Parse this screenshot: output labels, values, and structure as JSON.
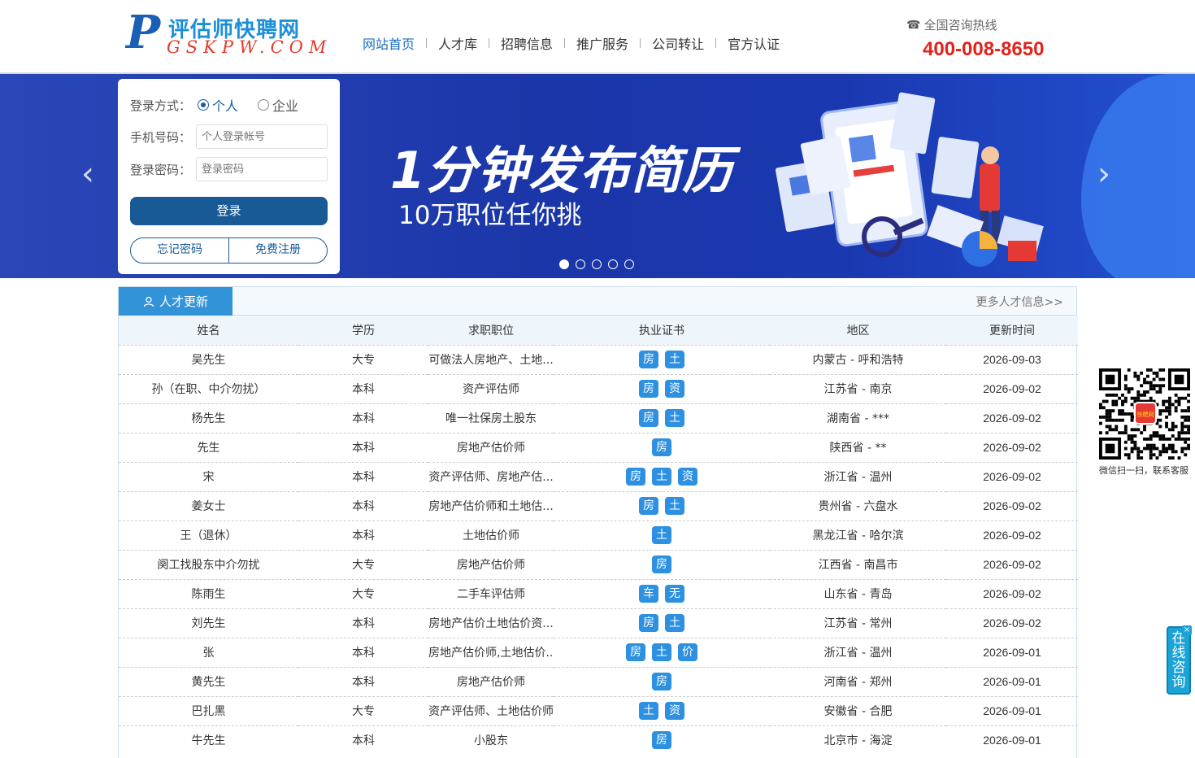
{
  "header": {
    "logo_cn": "评估师快聘网",
    "logo_en": "GSKPW.COM",
    "nav": [
      "网站首页",
      "人才库",
      "招聘信息",
      "推广服务",
      "公司转让",
      "官方认证"
    ],
    "hotline_label": "全国咨询热线",
    "hotline_number": "400-008-8650"
  },
  "banner": {
    "title": "1分钟发布简历",
    "subtitle": "10万职位任你挑",
    "slide_count": 5,
    "active_slide": 1
  },
  "login": {
    "mode_label": "登录方式：",
    "mode_personal": "个人",
    "mode_company": "企业",
    "phone_label": "手机号码：",
    "phone_placeholder": "个人登录帐号",
    "password_label": "登录密码：",
    "password_placeholder": "登录密码",
    "login_button": "登录",
    "forgot_button": "忘记密码",
    "register_button": "免费注册"
  },
  "talent": {
    "tab_title": "人才更新",
    "more_link": "更多人才信息>>",
    "columns": [
      "姓名",
      "学历",
      "求职职位",
      "执业证书",
      "地区",
      "更新时间"
    ],
    "rows": [
      {
        "name": "吴先生",
        "edu": "大专",
        "job": "可做法人房地产、土地...",
        "certs": [
          "房",
          "土"
        ],
        "region": "内蒙古 - 呼和浩特",
        "date": "2026-09-03"
      },
      {
        "name": "孙（在职、中介勿扰）",
        "edu": "本科",
        "job": "资产评估师",
        "certs": [
          "房",
          "资"
        ],
        "region": "江苏省 - 南京",
        "date": "2026-09-02"
      },
      {
        "name": "杨先生",
        "edu": "本科",
        "job": "唯一社保房土股东",
        "certs": [
          "房",
          "土"
        ],
        "region": "湖南省 - ***",
        "date": "2026-09-02"
      },
      {
        "name": "先生",
        "edu": "本科",
        "job": "房地产估价师",
        "certs": [
          "房"
        ],
        "region": "陕西省 - **",
        "date": "2026-09-02"
      },
      {
        "name": "宋",
        "edu": "本科",
        "job": "资产评估师、房地产估...",
        "certs": [
          "房",
          "土",
          "资"
        ],
        "region": "浙江省 - 温州",
        "date": "2026-09-02"
      },
      {
        "name": "姜女士",
        "edu": "本科",
        "job": "房地产估价师和土地估...",
        "certs": [
          "房",
          "土"
        ],
        "region": "贵州省 - 六盘水",
        "date": "2026-09-02"
      },
      {
        "name": "王（退休）",
        "edu": "本科",
        "job": "土地估价师",
        "certs": [
          "土"
        ],
        "region": "黑龙江省 - 哈尔滨",
        "date": "2026-09-02"
      },
      {
        "name": "阕工找股东中介勿扰",
        "edu": "大专",
        "job": "房地产估价师",
        "certs": [
          "房"
        ],
        "region": "江西省 - 南昌市",
        "date": "2026-09-02"
      },
      {
        "name": "陈雨生",
        "edu": "大专",
        "job": "二手车评估师",
        "certs": [
          "车",
          "无"
        ],
        "region": "山东省 - 青岛",
        "date": "2026-09-02"
      },
      {
        "name": "刘先生",
        "edu": "本科",
        "job": "房地产估价土地估价资...",
        "certs": [
          "房",
          "土"
        ],
        "region": "江苏省 - 常州",
        "date": "2026-09-02"
      },
      {
        "name": "张",
        "edu": "本科",
        "job": "房地产估价师,土地估价...",
        "certs": [
          "房",
          "土",
          "价"
        ],
        "region": "浙江省 - 温州",
        "date": "2026-09-01"
      },
      {
        "name": "黄先生",
        "edu": "本科",
        "job": "房地产估价师",
        "certs": [
          "房"
        ],
        "region": "河南省 - 郑州",
        "date": "2026-09-01"
      },
      {
        "name": "巴扎黑",
        "edu": "大专",
        "job": "资产评估师、土地估价师",
        "certs": [
          "土",
          "资"
        ],
        "region": "安徽省 - 合肥",
        "date": "2026-09-01"
      },
      {
        "name": "牛先生",
        "edu": "本科",
        "job": "小股东",
        "certs": [
          "房"
        ],
        "region": "北京市 - 海淀",
        "date": "2026-09-01"
      }
    ]
  },
  "sidebar": {
    "qr_caption": "微信扫一扫，联系客服",
    "qr_badge": "快聘网",
    "consult_label": "在线咨询",
    "consult_close": "×"
  },
  "icons": {
    "prev": "chevron-left-icon",
    "next": "chevron-right-icon",
    "phone": "phone-icon",
    "user": "user-icon"
  },
  "colors": {
    "brand_blue": "#175a95",
    "accent_blue": "#3393d8",
    "hotline_red": "#e5211b",
    "badge_blue": "#2e90e0"
  }
}
